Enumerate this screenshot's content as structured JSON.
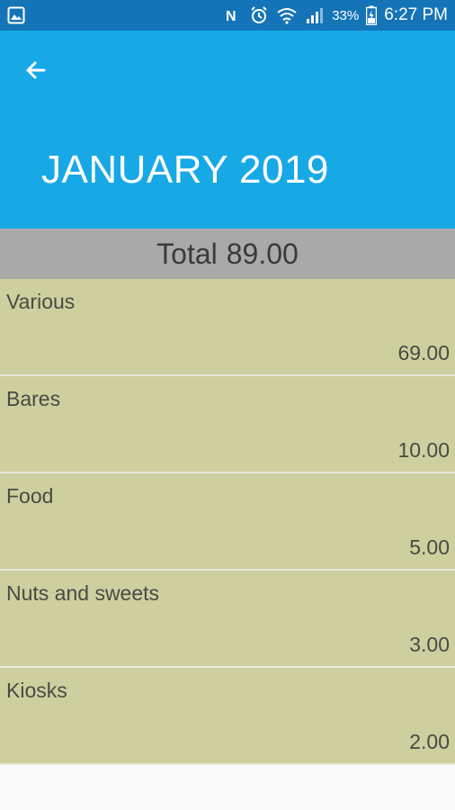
{
  "status_bar": {
    "battery_percent": "33%",
    "time": "6:27 PM",
    "icons": [
      "gallery-icon",
      "nfc-icon",
      "alarm-icon",
      "wifi-icon",
      "signal-icon",
      "battery-charging-icon"
    ]
  },
  "header": {
    "back_icon": "arrow-left-icon",
    "title": "JANUARY 2019",
    "color": "#17a8e6"
  },
  "total": {
    "label": "Total",
    "value": "89.00"
  },
  "categories": [
    {
      "label": "Various",
      "amount": "69.00"
    },
    {
      "label": "Bares",
      "amount": "10.00"
    },
    {
      "label": "Food",
      "amount": "5.00"
    },
    {
      "label": "Nuts and sweets",
      "amount": "3.00"
    },
    {
      "label": "Kiosks",
      "amount": "2.00"
    }
  ],
  "colors": {
    "status_bar": "#1574b8",
    "total_bar": "#a9a9a9",
    "row_background": "#cecf9f"
  }
}
